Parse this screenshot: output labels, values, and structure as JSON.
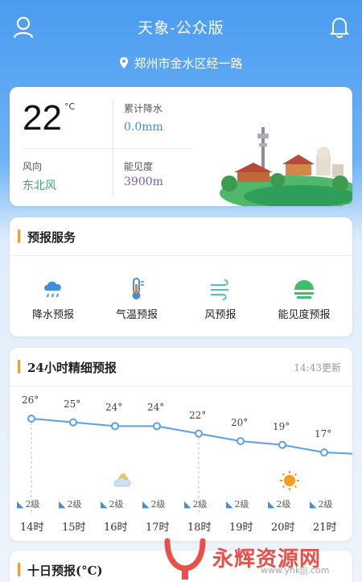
{
  "header": {
    "title": "天象-公众版",
    "location": "郑州市金水区经一路",
    "icons": {
      "user": "user-icon",
      "bell": "bell-icon",
      "pin": "location-pin-icon"
    }
  },
  "current": {
    "temperature": "22",
    "unit": "°C",
    "precip_label": "累计降水",
    "precip_value": "0.0mm",
    "wind_dir_label": "风向",
    "wind_dir_value": "东北风",
    "visibility_label": "能见度",
    "visibility_value": "3900m",
    "colors": {
      "precip": "#3a8ee6",
      "wind": "#3aa86a",
      "visibility": "#7a5bb8"
    }
  },
  "services": {
    "title": "预报服务",
    "items": [
      {
        "label": "降水预报",
        "icon": "rain-cloud-icon"
      },
      {
        "label": "气温预报",
        "icon": "thermometer-icon"
      },
      {
        "label": "风预报",
        "icon": "wind-icon"
      },
      {
        "label": "能见度预报",
        "icon": "visibility-icon"
      }
    ]
  },
  "hourly": {
    "title": "24小时精细预报",
    "updated": "14:43更新",
    "hours": [
      {
        "time": "14时",
        "temp": 26,
        "temp_label": "26°",
        "wind": "2级"
      },
      {
        "time": "15时",
        "temp": 25,
        "temp_label": "25°",
        "wind": "2级"
      },
      {
        "time": "16时",
        "temp": 24,
        "temp_label": "24°",
        "wind": "2级",
        "icon": "partly-cloudy-night-icon"
      },
      {
        "time": "17时",
        "temp": 24,
        "temp_label": "24°",
        "wind": "2级"
      },
      {
        "time": "18时",
        "temp": 22,
        "temp_label": "22°",
        "wind": "2级"
      },
      {
        "time": "19时",
        "temp": 20,
        "temp_label": "20°",
        "wind": "2级"
      },
      {
        "time": "20时",
        "temp": 19,
        "temp_label": "19°",
        "wind": "2级",
        "icon": "sun-icon"
      },
      {
        "time": "21时",
        "temp": 17,
        "temp_label": "17°",
        "wind": "2级"
      }
    ],
    "line_color": "#5aa0e8"
  },
  "tenday": {
    "title": "十日预报(°C)"
  },
  "watermark": {
    "text": "永辉资源网",
    "url": "www.yhkjjj.com"
  }
}
